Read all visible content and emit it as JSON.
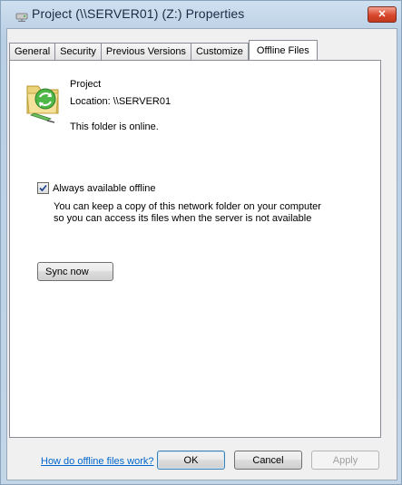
{
  "window": {
    "title": "Project (\\\\SERVER01) (Z:) Properties",
    "close_glyph": "✕",
    "title_icon": "network-drive-icon"
  },
  "tabs": [
    {
      "label": "General"
    },
    {
      "label": "Security"
    },
    {
      "label": "Previous Versions"
    },
    {
      "label": "Customize"
    },
    {
      "label": "Offline Files",
      "active": true
    }
  ],
  "folder": {
    "icon": "offline-folder-sync-icon",
    "name": "Project",
    "location": "Location:  \\\\SERVER01",
    "status": "This folder is online."
  },
  "offline": {
    "checkbox_label": "Always available offline",
    "checked": true,
    "description_line1": "You can keep a copy of this network folder on your computer",
    "description_line2": "so you can access its files when the server is not available"
  },
  "sync_button": "Sync now",
  "help_link": "How do offline files work?",
  "buttons": {
    "ok": "OK",
    "cancel": "Cancel",
    "apply": "Apply"
  }
}
